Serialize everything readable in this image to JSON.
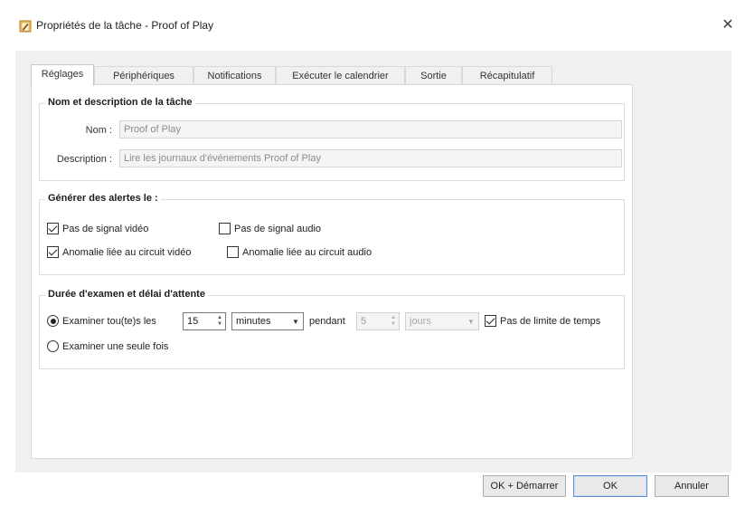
{
  "window": {
    "title": "Propriétés de la tâche - Proof of Play",
    "close_glyph": "✕"
  },
  "tabs": [
    {
      "label": "Réglages",
      "active": true
    },
    {
      "label": "Périphériques",
      "active": false
    },
    {
      "label": "Notifications",
      "active": false
    },
    {
      "label": "Exécuter le calendrier",
      "active": false
    },
    {
      "label": "Sortie",
      "active": false
    },
    {
      "label": "Récapitulatif",
      "active": false
    }
  ],
  "task_group": {
    "title": "Nom et description de la tâche",
    "name_label": "Nom :",
    "name_value": "Proof of Play",
    "description_label": "Description :",
    "description_value": "Lire les journaux d'événements Proof of Play"
  },
  "alerts_group": {
    "title": "Générer des alertes le :",
    "options": [
      {
        "label": "Pas de signal vidéo",
        "checked": true
      },
      {
        "label": "Pas de signal audio",
        "checked": false
      },
      {
        "label": "Anomalie liée au circuit vidéo",
        "checked": true
      },
      {
        "label": "Anomalie liée au circuit audio",
        "checked": false
      }
    ]
  },
  "duration_group": {
    "title": "Durée d'examen et délai d'attente",
    "radio_every_label": "Examiner tou(te)s les",
    "radio_every_checked": true,
    "interval_value": "15",
    "interval_unit": "minutes",
    "during_label": "pendant",
    "duration_value": "5",
    "duration_unit": "jours",
    "no_limit_label": "Pas de limite de temps",
    "no_limit_checked": true,
    "radio_once_label": "Examiner une seule fois",
    "radio_once_checked": false
  },
  "buttons": {
    "ok_start": "OK + Démarrer",
    "ok": "OK",
    "cancel": "Annuler"
  },
  "icons": {
    "app": "task-properties-icon",
    "close": "close-icon",
    "spin": "spin-arrows-icon",
    "dropdown": "chevron-down-icon"
  }
}
